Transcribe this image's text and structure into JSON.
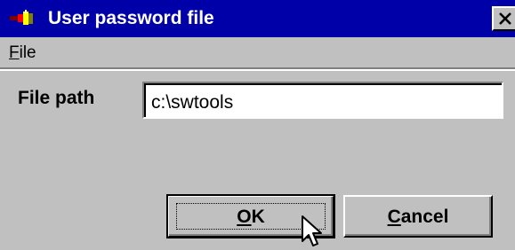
{
  "window": {
    "title": "User password file",
    "title_icon": "swtools-app-icon",
    "close_icon": "close-icon",
    "colors": {
      "titlebar": "#0000a8",
      "face": "#c0c0c0"
    }
  },
  "menu": {
    "items": [
      {
        "label_first": "F",
        "label_rest": "ile"
      }
    ]
  },
  "form": {
    "file_path_label": "File path",
    "file_path_value": "c:\\swtools"
  },
  "buttons": {
    "ok": {
      "label_first": "O",
      "label_rest": "K"
    },
    "cancel": {
      "label_first": "C",
      "label_rest": "ancel"
    }
  },
  "cursor_icon": "arrow-cursor-icon"
}
